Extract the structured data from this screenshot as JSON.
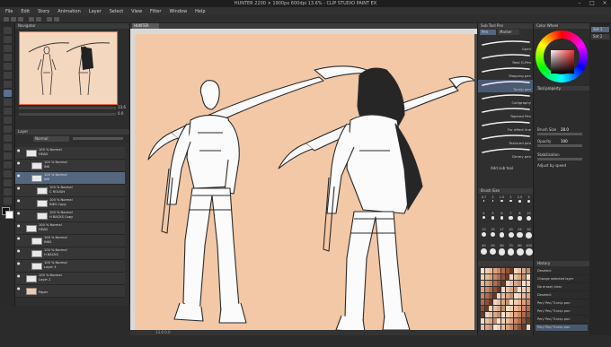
{
  "window": {
    "title": "HUNTER 2200 × 1900px 600dpi 13.6% - CLIP STUDIO PAINT EX"
  },
  "menu": [
    "File",
    "Edit",
    "Story",
    "Animation",
    "Layer",
    "Select",
    "View",
    "Filter",
    "Window",
    "Help"
  ],
  "navigator": {
    "title": "Navigator",
    "zoom": "13.6",
    "angle": "0.0"
  },
  "layers": {
    "title": "Layer",
    "blend": "Normal",
    "rows": [
      {
        "name": "100 % Normal",
        "sub": "HEAD",
        "sel": false,
        "indent": 0
      },
      {
        "name": "100 % Normal",
        "sub": "INK",
        "sel": false,
        "indent": 1
      },
      {
        "name": "100 % Normal",
        "sub": "INK",
        "sel": true,
        "indent": 1
      },
      {
        "name": "100 % Normal",
        "sub": "C ROUGH",
        "sel": false,
        "indent": 2
      },
      {
        "name": "100 % Normal",
        "sub": "INKS Copy",
        "sel": false,
        "indent": 2
      },
      {
        "name": "100 % Normal",
        "sub": "H BACKS Copy",
        "sel": false,
        "indent": 2
      },
      {
        "name": "100 % Normal",
        "sub": "HEAD",
        "sel": false,
        "indent": 0
      },
      {
        "name": "100 % Normal",
        "sub": "INKS",
        "sel": false,
        "indent": 1
      },
      {
        "name": "100 % Normal",
        "sub": "H BACKS",
        "sel": false,
        "indent": 1
      },
      {
        "name": "100 % Normal",
        "sub": "Layer 3",
        "sel": false,
        "indent": 1
      },
      {
        "name": "100 % Normal",
        "sub": "Layer 2",
        "sel": false,
        "indent": 0
      },
      {
        "name": "",
        "sub": "Paper",
        "sel": false,
        "indent": 0
      }
    ]
  },
  "canvas": {
    "tab": "HUNTER",
    "status": "13.6  0.0"
  },
  "brushes": {
    "tabs": [
      "Pen",
      "Marker"
    ],
    "group": "Sub Tool Pen",
    "items": [
      "Gpen",
      "Real G-Pen",
      "Mapping pen",
      "Turnip pen",
      "Calligraphy",
      "Tapered Pen",
      "For effect line",
      "Textured pen",
      "Dmmy pen"
    ],
    "selected_index": 3,
    "add_label": "Add sub tool"
  },
  "tool_property": {
    "title": "Tool property",
    "brush_size_label": "Brush Size",
    "brush_size": "28.0",
    "opacity_label": "Opacity",
    "opacity": "100",
    "stabilization_label": "Stabilization",
    "adjust_label": "Adjust by speed"
  },
  "brush_size_panel": {
    "title": "Brush Size",
    "values": [
      "0.7",
      "1",
      "1.5",
      "2",
      "2.5",
      "3",
      "4",
      "5",
      "6",
      "7",
      "8",
      "10",
      "12",
      "15",
      "17",
      "20",
      "25",
      "30",
      "40",
      "50",
      "60",
      "70",
      "80",
      "100"
    ]
  },
  "history": {
    "title": "History",
    "items": [
      "Deselect",
      "Change selected layer",
      "No erase/ clear",
      "Deselect",
      "Pen/ Pen/ Turnip pen",
      "Pen/ Pen/ Turnip pen",
      "Pen/ Pen/ Turnip pen",
      "Pen/ Pen/ Turnip pen"
    ]
  },
  "color": {
    "title": "Color Wheel",
    "accent": "#ff3030"
  },
  "right_tabs": [
    "Set 1",
    "Set 2"
  ]
}
